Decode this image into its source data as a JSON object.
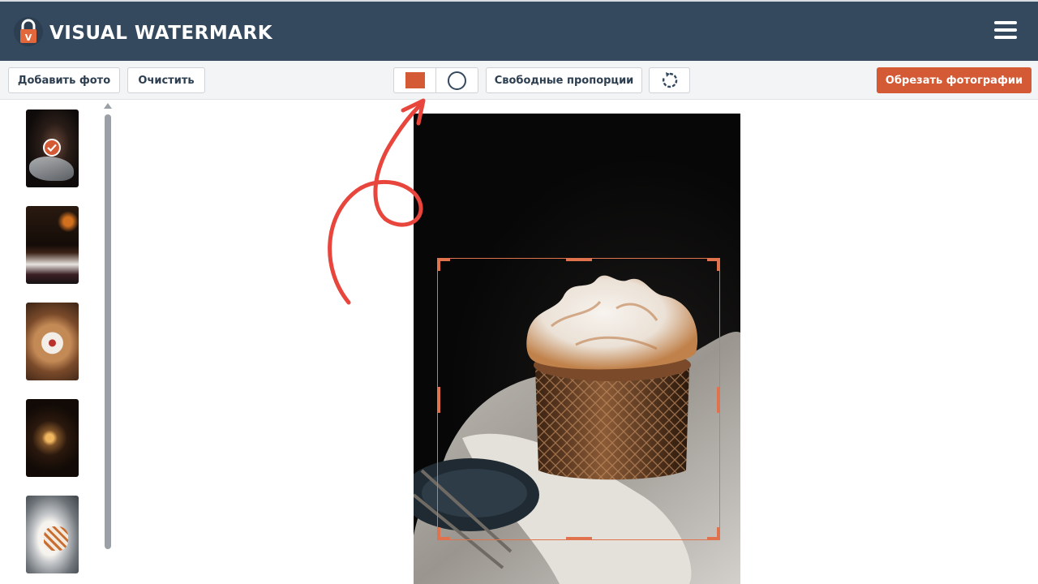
{
  "header": {
    "brand": "VISUAL WATERMARK",
    "logo_letter": "V",
    "menu_icon": "hamburger-icon"
  },
  "toolbar": {
    "add_photo": "Добавить фото",
    "clear": "Очистить",
    "shape_rect_icon": "square-icon",
    "shape_circle_icon": "circle-icon",
    "ratio": "Свободные пропорции",
    "rotate_icon": "rotate-icon",
    "crop": "Обрезать фотографии"
  },
  "sidebar": {
    "thumbnails": 5,
    "selected_index": 0
  },
  "colors": {
    "header_bg": "#34495e",
    "accent": "#d35a34",
    "annotation": "#e8453c"
  }
}
